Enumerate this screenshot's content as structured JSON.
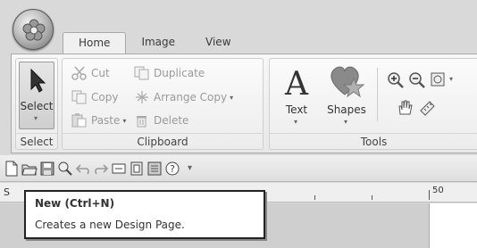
{
  "tabs": [
    {
      "label": "Home",
      "active": true
    },
    {
      "label": "Image",
      "active": false
    },
    {
      "label": "View",
      "active": false
    }
  ],
  "ribbon": {
    "select_group": {
      "button_label": "Select",
      "group_label": "Select"
    },
    "clipboard": {
      "group_label": "Clipboard",
      "cut": "Cut",
      "copy": "Copy",
      "paste": "Paste",
      "duplicate": "Duplicate",
      "arrange_copy": "Arrange Copy",
      "delete": "Delete"
    },
    "tools": {
      "group_label": "Tools",
      "text": "Text",
      "shapes": "Shapes"
    }
  },
  "ruler": {
    "mark": "50",
    "left_letter": "S"
  },
  "tooltip": {
    "title": "New (Ctrl+N)",
    "description": "Creates a new Design Page."
  },
  "colors": {
    "shape_accent": "#8a8a8a",
    "ribbon_bg": "#f0f0f0"
  }
}
